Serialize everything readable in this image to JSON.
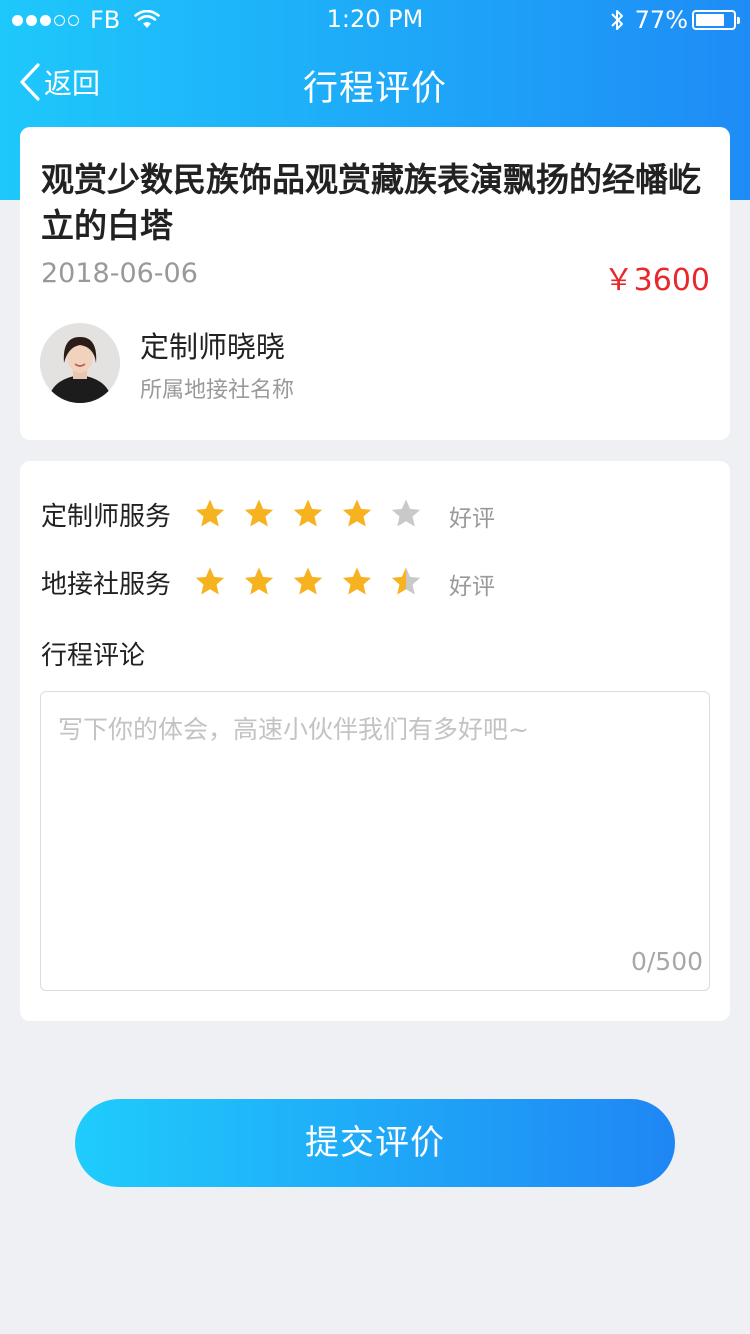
{
  "status_bar": {
    "carrier": "FB",
    "time": "1:20 PM",
    "battery_text": "77%",
    "battery_level": 0.77,
    "signal_filled": 3,
    "signal_total": 5
  },
  "nav": {
    "back_label": "返回",
    "title": "行程评价"
  },
  "trip": {
    "title": "观赏少数民族饰品观赏藏族表演飘扬的经幡屹立的白塔",
    "date": "2018-06-06",
    "price": "￥3600"
  },
  "guide": {
    "name": "定制师晓晓",
    "agency": "所属地接社名称"
  },
  "ratings": [
    {
      "label": "定制师服务",
      "stars": 4,
      "max": 5,
      "text": "好评"
    },
    {
      "label": "地接社服务",
      "stars": 4.5,
      "max": 5,
      "text": "好评"
    }
  ],
  "comment": {
    "label": "行程评论",
    "placeholder": "写下你的体会，高速小伙伴我们有多好吧~",
    "value": "",
    "count": "0/500"
  },
  "submit_label": "提交评价",
  "colors": {
    "gradient_start": "#1ec8fb",
    "gradient_end": "#1e8cf6",
    "star_active": "#f7b31f",
    "star_inactive": "#c9c9c9",
    "price": "#e8282b"
  }
}
